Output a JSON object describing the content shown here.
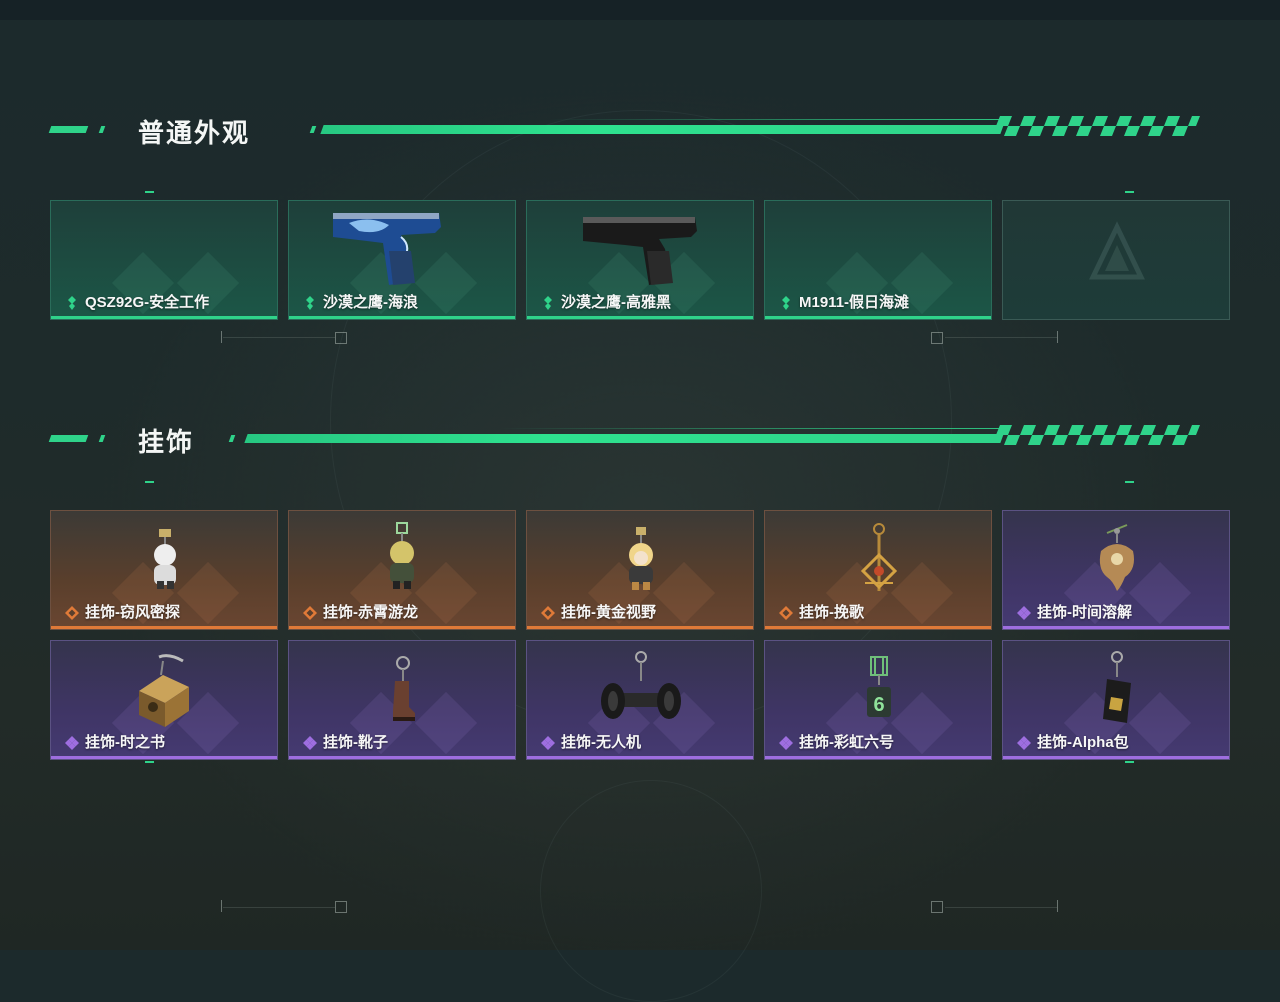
{
  "sections": {
    "appearance": {
      "title": "普通外观",
      "cards": [
        {
          "label": "QSZ92G-安全工作",
          "rarity": "green",
          "icon": "empty"
        },
        {
          "label": "沙漠之鹰-海浪",
          "rarity": "green",
          "icon": "desert-eagle-wave-pistol"
        },
        {
          "label": "沙漠之鹰-高雅黑",
          "rarity": "green",
          "icon": "desert-eagle-black-pistol"
        },
        {
          "label": "M1911-假日海滩",
          "rarity": "green",
          "icon": "empty"
        },
        {
          "label": "",
          "rarity": "empty",
          "icon": "faded-logo"
        }
      ]
    },
    "charms": {
      "title": "挂饰",
      "cards": [
        {
          "label": "挂饰-窃风密探",
          "rarity": "orange",
          "icon": "white-figure-charm"
        },
        {
          "label": "挂饰-赤霄游龙",
          "rarity": "orange",
          "icon": "dragon-figure-charm"
        },
        {
          "label": "挂饰-黄金视野",
          "rarity": "orange",
          "icon": "blonde-figure-charm"
        },
        {
          "label": "挂饰-挽歌",
          "rarity": "orange",
          "icon": "golden-emblem-charm"
        },
        {
          "label": "挂饰-时间溶解",
          "rarity": "purple",
          "icon": "melting-clock-charm"
        },
        {
          "label": "挂饰-时之书",
          "rarity": "purple",
          "icon": "book-charm"
        },
        {
          "label": "挂饰-靴子",
          "rarity": "purple",
          "icon": "boot-charm"
        },
        {
          "label": "挂饰-无人机",
          "rarity": "purple",
          "icon": "drone-charm"
        },
        {
          "label": "挂饰-彩虹六号",
          "rarity": "purple",
          "icon": "rainbow-six-charm"
        },
        {
          "label": "挂饰-Alpha包",
          "rarity": "purple",
          "icon": "alpha-bag-charm"
        }
      ]
    }
  },
  "colors": {
    "accent_green": "#2fd38a",
    "rarity_green": "#2fd38a",
    "rarity_orange": "#e07a38",
    "rarity_purple": "#9e6ee0"
  }
}
